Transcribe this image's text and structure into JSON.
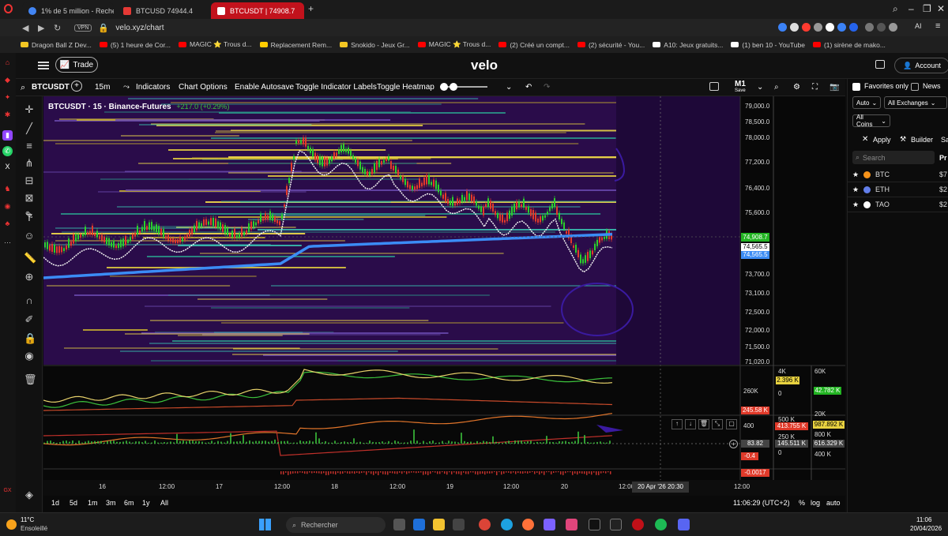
{
  "browser": {
    "tabs": [
      {
        "title": "1% de 5 million - Recherch",
        "color": "#4285f4"
      },
      {
        "title": "BTCUSD 74944.4",
        "color": "#e53935"
      },
      {
        "title": "BTCUSDT | 74908.7",
        "color": "#ffffff",
        "active": true
      }
    ],
    "new_tab": "+",
    "vpn": "VPN",
    "url": "velo.xyz/chart",
    "ai": "AI",
    "bookmarks": [
      {
        "label": "Dragon Ball Z Dev...",
        "color": "#f3c623"
      },
      {
        "label": "(5) 1 heure de Cor...",
        "color": "#ff0000"
      },
      {
        "label": "MAGIC ⭐ Trous d...",
        "color": "#ff0000"
      },
      {
        "label": "Replacement Rem...",
        "color": "#ffcc00"
      },
      {
        "label": "Snokido - Jeux Gr...",
        "color": "#f3c623"
      },
      {
        "label": "MAGIC ⭐ Trous d...",
        "color": "#ff0000"
      },
      {
        "label": "(2) Créé un compt...",
        "color": "#ff0000"
      },
      {
        "label": "(2) sécurité - You...",
        "color": "#ff0000"
      },
      {
        "label": "A10: Jeux gratuits...",
        "color": "#ffffff"
      },
      {
        "label": "(1) ben 10 - YouTube",
        "color": "#ffffff"
      },
      {
        "label": "(1) sirène de mako...",
        "color": "#ff0000"
      }
    ]
  },
  "app": {
    "trade_label": "Trade",
    "logo": "velo",
    "account_label": "Account"
  },
  "toolbar": {
    "symbol": "BTCUSDT",
    "timeframe": "15m",
    "indicators": "Indicators",
    "chart_options": "Chart Options",
    "autosave": "Enable Autosave",
    "toggle_labels": "Toggle Indicator Labels",
    "toggle_heatmap": "Toggle Heatmap",
    "m1": "M1",
    "save": "Save"
  },
  "chart": {
    "legend_symbol": "BTCUSDT · 15 · Binance-Futures",
    "legend_change": "+217.0 (+0.29%)",
    "price_ticks": [
      "79,000.0",
      "78,500.0",
      "78,000.0",
      "77,200.0",
      "76,400.0",
      "75,600.0",
      "73,700.0",
      "73,100.0",
      "72,500.0",
      "72,000.0",
      "71,500.0",
      "71,020.0"
    ],
    "last_price": "74,908.7",
    "price_white": "74,565.5",
    "price_blue": "74,565.5",
    "time_ticks": [
      "16",
      "12:00",
      "17",
      "12:00",
      "18",
      "12:00",
      "19",
      "12:00",
      "20",
      "12:00",
      "12:00"
    ],
    "crosshair_time": "20 Apr '26  20:30",
    "panel2": {
      "left_axis": [
        "4K",
        "0"
      ],
      "mid_axis": [
        "60K",
        "20K"
      ],
      "label_260k": "260K",
      "tag_yellow": "2.396 K",
      "tag_green": "42.782 K",
      "tag_red": "245.58 K"
    },
    "panel3": {
      "label_400": "400",
      "tag_red": "413.755 K",
      "tag_yellow": "987.892 K",
      "label_500k": "500 K",
      "label_250k": "250 K",
      "label_800k": "800 K",
      "val_8382": "83.82",
      "val_145": "145.511 K",
      "val_616": "616.329 K",
      "label_0": "0",
      "label_400k": "400 K",
      "tag_neg04": "-0.4"
    },
    "panel4": {
      "tag": "-0.0017"
    },
    "ranges": [
      "1d",
      "5d",
      "1m",
      "3m",
      "6m",
      "1y",
      "All"
    ],
    "clock": "11:06:29 (UTC+2)",
    "pct": "%",
    "log": "log",
    "auto": "auto"
  },
  "right_panel": {
    "favorites": "Favorites only",
    "news": "News",
    "auto": "Auto",
    "exchanges": "All Exchanges",
    "coins": "All Coins",
    "apply": "Apply",
    "builder": "Builder",
    "search": "Search",
    "col_pr": "Pr",
    "assets": [
      {
        "name": "BTC",
        "price": "$7",
        "icon_color": "#f7931a"
      },
      {
        "name": "ETH",
        "price": "$2",
        "icon_color": "#627eea"
      },
      {
        "name": "TAO",
        "price": "$2",
        "icon_color": "#ffffff"
      }
    ]
  },
  "taskbar": {
    "weather_temp": "11°C",
    "weather_desc": "Ensoleillé",
    "search": "Rechercher",
    "time": "11:06",
    "date": "20/04/2026"
  }
}
